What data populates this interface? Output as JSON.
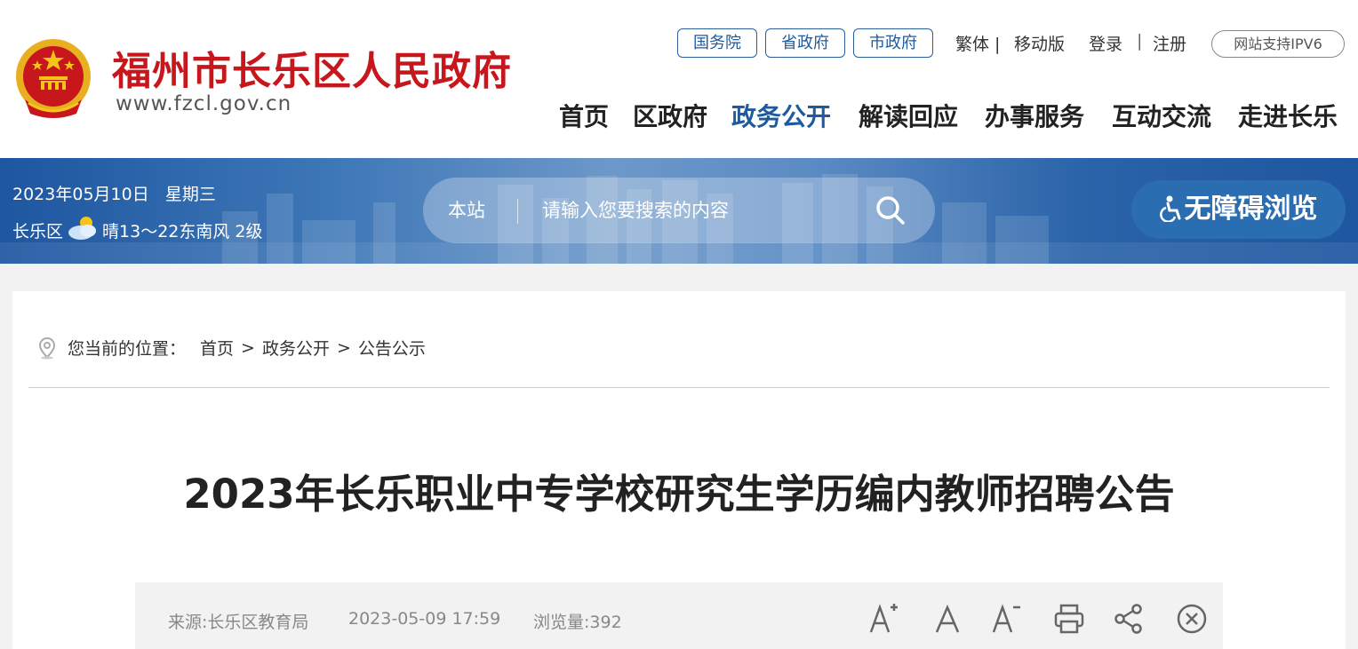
{
  "header": {
    "site_name": "福州市长乐区人民政府",
    "site_url": "www.fzcl.gov.cn",
    "gov_links": [
      "国务院",
      "省政府",
      "市政府"
    ],
    "util": {
      "traditional": "繁体 |",
      "mobile": "移动版",
      "login": "登录",
      "sep": "|",
      "register": "注册"
    },
    "ipv6": "网站支持IPV6",
    "nav": [
      "首页",
      "区政府",
      "政务公开",
      "解读回应",
      "办事服务",
      "互动交流",
      "走进长乐"
    ],
    "active_nav": "政务公开"
  },
  "banner": {
    "date": "2023年05月10日",
    "weekday": "星期三",
    "location": "长乐区",
    "weather": "晴13～22东南风 2级",
    "search_scope": "本站",
    "search_placeholder": "请输入您要搜索的内容",
    "accessibility": "无障碍浏览"
  },
  "article": {
    "location_label": "您当前的位置：",
    "breadcrumb": [
      "首页",
      ">",
      "政务公开",
      ">",
      "公告公示"
    ],
    "title": "2023年长乐职业中专学校研究生学历编内教师招聘公告",
    "source": "来源:长乐区教育局",
    "datetime": "2023-05-09 17:59",
    "views": "浏览量:392",
    "tools": [
      "font-increase-icon",
      "font-normal-icon",
      "font-decrease-icon",
      "print-icon",
      "share-icon",
      "close-icon"
    ]
  },
  "colors": {
    "brand_red": "#c8161d",
    "brand_blue": "#1f5a9e",
    "banner_blue": "#1e56a0"
  }
}
